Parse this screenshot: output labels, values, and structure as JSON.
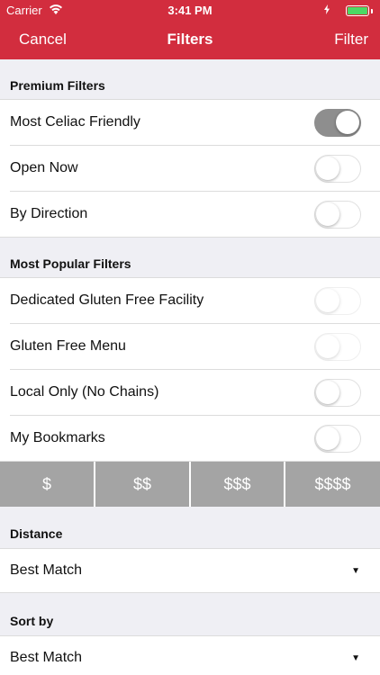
{
  "status_bar": {
    "carrier": "Carrier",
    "time": "3:41 PM",
    "battery_level_percent": 100
  },
  "nav": {
    "cancel_label": "Cancel",
    "title": "Filters",
    "filter_label": "Filter"
  },
  "premium": {
    "header": "Premium Filters",
    "items": [
      {
        "label": "Most Celiac Friendly",
        "on": true,
        "enabled": true
      },
      {
        "label": "Open Now",
        "on": false,
        "enabled": true
      },
      {
        "label": "By Direction",
        "on": false,
        "enabled": true
      }
    ]
  },
  "popular": {
    "header": "Most Popular Filters",
    "items": [
      {
        "label": "Dedicated Gluten Free Facility",
        "on": false,
        "enabled": false
      },
      {
        "label": "Gluten Free Menu",
        "on": false,
        "enabled": false
      },
      {
        "label": "Local Only (No Chains)",
        "on": false,
        "enabled": true
      },
      {
        "label": "My Bookmarks",
        "on": false,
        "enabled": true
      }
    ]
  },
  "price": {
    "options": [
      "$",
      "$$",
      "$$$",
      "$$$$"
    ]
  },
  "distance": {
    "header": "Distance",
    "value": "Best Match"
  },
  "sort": {
    "header": "Sort by",
    "value": "Best Match"
  },
  "colors": {
    "brand_red": "#d22d3e",
    "toggle_on": "#8e8e8e",
    "price_segment": "#a4a4a4",
    "battery_green": "#4cd964"
  },
  "icons": {
    "wifi": "wifi-icon",
    "charging": "charging-icon",
    "battery": "battery-icon",
    "dropdown": "dropdown-caret-icon"
  }
}
